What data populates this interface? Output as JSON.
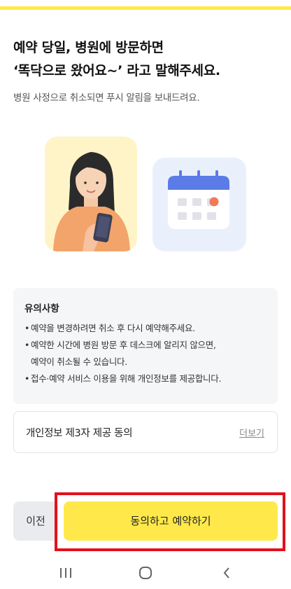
{
  "screen": {
    "headline_line1": "예약 당일, 병원에 방문하면",
    "headline_line2": "‘똑닥으로 왔어요~’ 라고 말해주세요.",
    "subtitle": "병원 사정으로 취소되면 푸시 알림을 보내드려요."
  },
  "illustrations": {
    "person": "person-holding-phone",
    "calendar": "calendar-icon"
  },
  "notice": {
    "title": "유의사항",
    "items": [
      "예약을 변경하려면 취소 후 다시 예약해주세요.",
      "예약한 시간에 병원 방문 후 데스크에 알리지 않으면,",
      "예약이 취소될 수 있습니다.",
      "접수·예약 서비스 이용을 위해 개인정보를 제공합니다."
    ]
  },
  "consent": {
    "label": "개인정보 제3자 제공 동의",
    "more_link": "더보기"
  },
  "actions": {
    "prev_label": "이전",
    "agree_label": "동의하고 예약하기"
  },
  "colors": {
    "accent_yellow": "#ffe94a",
    "highlight_red": "#e2111a",
    "calendar_blue": "#5b7ce6",
    "calendar_dot": "#f07a5a"
  },
  "nav": {
    "recent": "recent-apps-icon",
    "home": "home-icon",
    "back": "back-icon"
  }
}
